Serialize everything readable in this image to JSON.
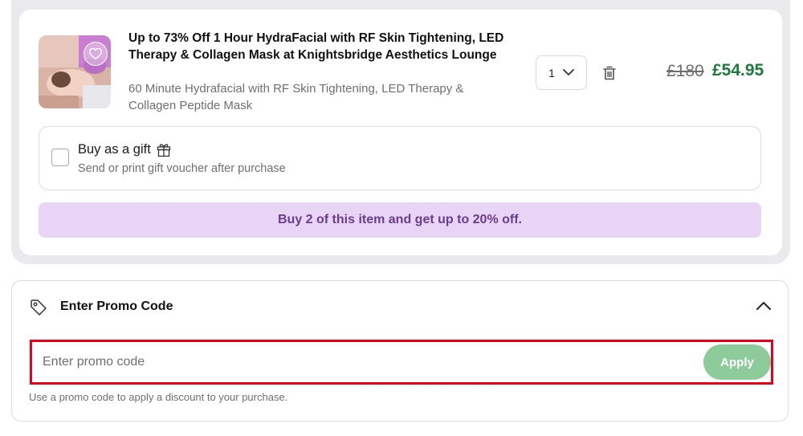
{
  "product": {
    "title": "Up to 73% Off 1 Hour HydraFacial with RF Skin Tightening, LED Therapy & Collagen Mask at Knightsbridge Aesthetics Lounge",
    "subtitle": "60 Minute Hydrafacial with RF Skin Tightening, LED Therapy & Collagen Peptide Mask",
    "quantity": "1",
    "old_price": "£180",
    "new_price": "£54.95",
    "image_icon": "favourite-heart-icon"
  },
  "gift": {
    "label": "Buy as a gift",
    "subtext": "Send or print gift voucher after purchase",
    "checked": false
  },
  "promo_banner": {
    "text": "Buy 2 of this item and get up to 20% off."
  },
  "promo_code": {
    "title": "Enter Promo Code",
    "placeholder": "Enter promo code",
    "value": "",
    "apply_label": "Apply",
    "help": "Use a promo code to apply a discount to your purchase."
  },
  "colors": {
    "price_green": "#1e7a3b",
    "banner_bg": "#e8d4f5",
    "banner_text": "#6a3d8c",
    "apply_bg": "#8ecb9b",
    "highlight_border": "#e3001b"
  }
}
